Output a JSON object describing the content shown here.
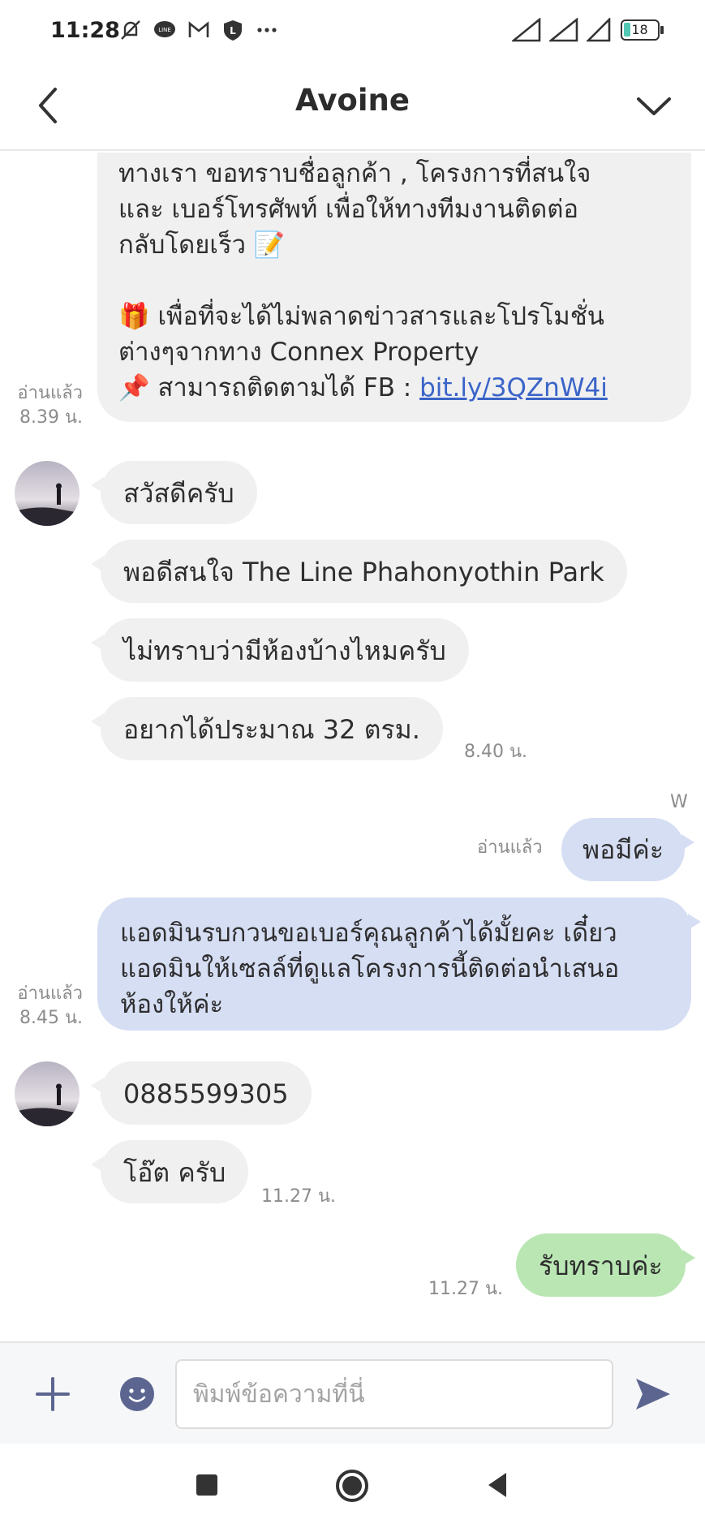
{
  "status": {
    "time": "11:28",
    "battery": "18"
  },
  "header": {
    "title": "Avoine"
  },
  "messages": {
    "m1": {
      "lines": [
        "ทางเรา ขอทราบชื่อลูกค้า , โครงการที่สนใจ",
        "และ เบอร์โทรศัพท์ เพื่อให้ทางทีมงานติดต่อ",
        "กลับโดยเร็ว 📝",
        "",
        "🎁 เพื่อที่จะได้ไม่พลาดข่าวสารและโปรโมชั่น",
        "ต่างๆจากทาง Connex Property"
      ],
      "last_prefix": "📌 สามารถติดตามได้ FB : ",
      "link": "bit.ly/3QZnW4i",
      "read": "อ่านแล้ว",
      "time": "8.39 น."
    },
    "m2": {
      "text": "สวัสดีครับ"
    },
    "m3": {
      "text": "พอดีสนใจ The Line Phahonyothin Park"
    },
    "m4": {
      "text": "ไม่ทราบว่ามีห้องบ้างไหมครับ"
    },
    "m5": {
      "text": "อยากได้ประมาณ 32 ตรม.",
      "time": "8.40 น."
    },
    "sender_w": "W",
    "m6": {
      "text": "พอมีค่ะ",
      "read": "อ่านแล้ว"
    },
    "m7": {
      "lines": [
        "แอดมินรบกวนขอเบอร์คุณลูกค้าได้มั้ยคะ เดี๋ยว",
        "แอดมินให้เซลล์ที่ดูแลโครงการนี้ติดต่อนำเสนอ",
        "ห้องให้ค่ะ"
      ],
      "read": "อ่านแล้ว",
      "time": "8.45 น."
    },
    "m8": {
      "text": "0885599305"
    },
    "m9": {
      "text": "โอ๊ต ครับ",
      "time": "11.27 น."
    },
    "m10": {
      "text": "รับทราบค่ะ",
      "time": "11.27 น."
    }
  },
  "input": {
    "placeholder": "พิมพ์ข้อความที่นี่"
  },
  "icons": {
    "back": "chevron-left-icon",
    "menu": "chevron-down-icon",
    "plus": "plus-icon",
    "emoji": "emoji-icon",
    "send": "send-icon"
  },
  "colors": {
    "incoming_bubble": "#f0f0f1",
    "outgoing_bubble": "#d6def4",
    "outgoing_green": "#b9e6b3",
    "accent": "#5b6590"
  }
}
